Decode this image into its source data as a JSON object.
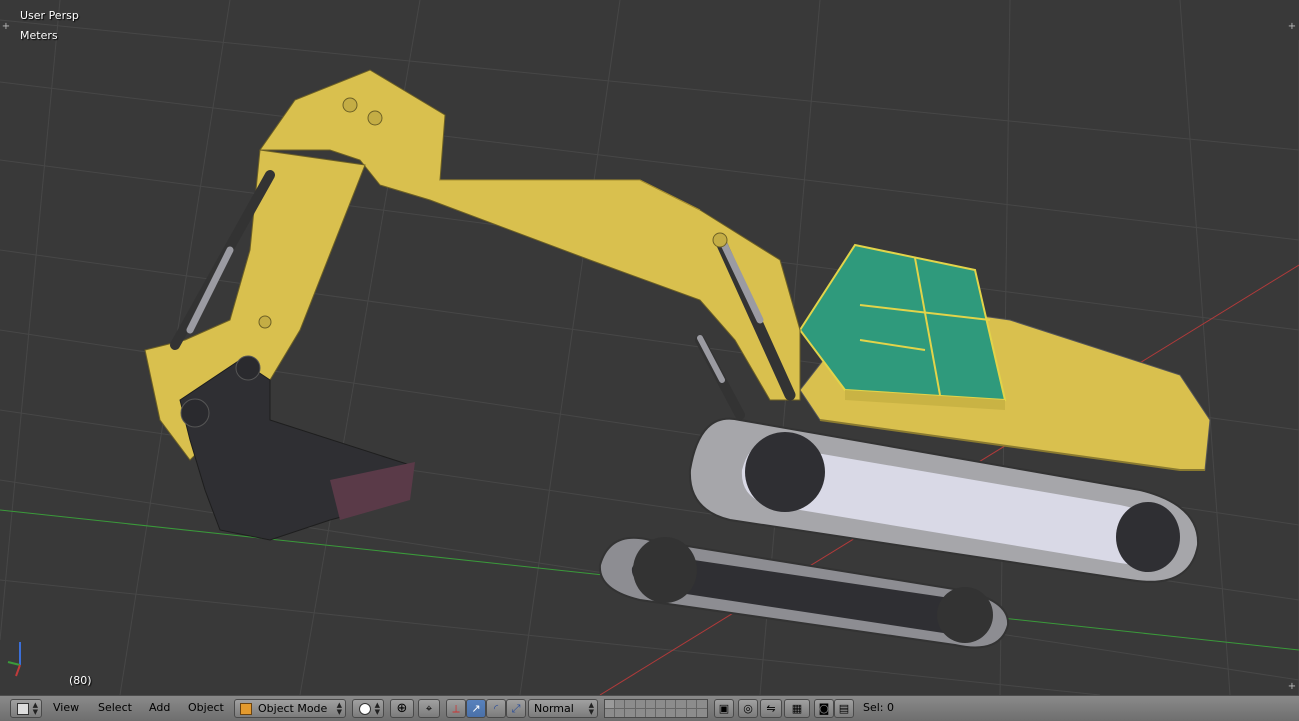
{
  "viewport": {
    "view_name": "User Persp",
    "units": "Meters",
    "frame": "(80)"
  },
  "header": {
    "editor_type_icon": "cube-icon",
    "menus": [
      "View",
      "Select",
      "Add",
      "Object"
    ],
    "mode": "Object Mode",
    "mode_icon": "cube-icon",
    "shading_icon": "solid-sphere-icon",
    "pivot_icon": "pivot-icon",
    "transform_orientation": "Normal",
    "status": "Sel: 0"
  },
  "colors": {
    "background": "#393939",
    "grid": "#474747",
    "x_axis": "#b03a3a",
    "y_axis": "#3a9a3a",
    "excavator_yellow": "#d9c04e",
    "cab_glass": "#2f9a7c",
    "track_grey": "#a6a6aa",
    "header_bg": "#7a7a7a"
  }
}
